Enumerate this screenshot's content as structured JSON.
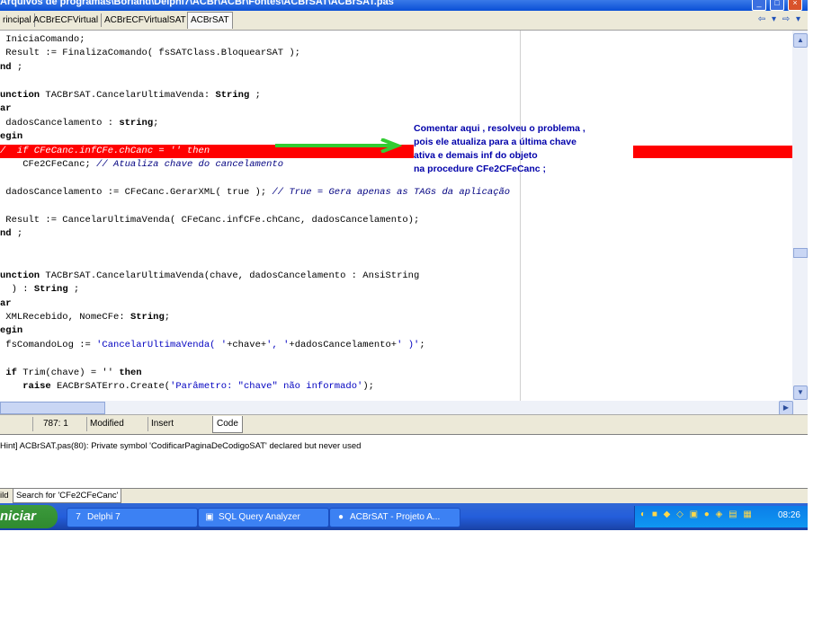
{
  "window": {
    "title": "Arquivos de programas\\Borland\\Delphi7\\ACBr\\ACBr\\Fontes\\ACBrSAT\\ACBrSAT.pas",
    "minimize_label": "_",
    "maximize_label": "□",
    "close_label": "×"
  },
  "tabs": [
    {
      "label": "rincipal"
    },
    {
      "label": "ACBrECFVirtual"
    },
    {
      "label": "ACBrECFVirtualSAT"
    },
    {
      "label": "ACBrSAT"
    }
  ],
  "nav": {
    "back_forward": "⇦ ▾ ⇨ ▾"
  },
  "code_lines": [
    {
      "parts": [
        {
          "t": " IniciaComando;",
          "c": ""
        }
      ]
    },
    {
      "parts": [
        {
          "t": " Result := FinalizaComando( fsSATClass.BloquearSAT );",
          "c": ""
        }
      ]
    },
    {
      "parts": [
        {
          "t": "nd",
          "c": "kw"
        },
        {
          "t": " ;",
          "c": ""
        }
      ]
    },
    {
      "parts": [
        {
          "t": "",
          "c": ""
        }
      ]
    },
    {
      "parts": [
        {
          "t": "unction",
          "c": "kw"
        },
        {
          "t": " TACBrSAT.CancelarUltimaVenda: ",
          "c": ""
        },
        {
          "t": "String",
          "c": "kw"
        },
        {
          "t": " ;",
          "c": ""
        }
      ]
    },
    {
      "parts": [
        {
          "t": "ar",
          "c": "kw"
        }
      ]
    },
    {
      "parts": [
        {
          "t": " dadosCancelamento : ",
          "c": ""
        },
        {
          "t": "string",
          "c": "kw"
        },
        {
          "t": ";",
          "c": ""
        }
      ]
    },
    {
      "parts": [
        {
          "t": "egin",
          "c": "kw"
        }
      ]
    },
    {
      "bp": true,
      "parts": [
        {
          "t": "/  if CFeCanc.infCFe.chCanc = '' then",
          "c": "cmt"
        }
      ]
    },
    {
      "parts": [
        {
          "t": "    CFe2CFeCanc; ",
          "c": ""
        },
        {
          "t": "// Atualiza chave do cancelamento",
          "c": "cmt"
        }
      ]
    },
    {
      "parts": [
        {
          "t": "",
          "c": ""
        }
      ]
    },
    {
      "parts": [
        {
          "t": " dadosCancelamento := CFeCanc.GerarXML( true ); ",
          "c": ""
        },
        {
          "t": "// True = Gera apenas as TAGs da aplicação",
          "c": "cmt"
        }
      ]
    },
    {
      "parts": [
        {
          "t": "",
          "c": ""
        }
      ]
    },
    {
      "parts": [
        {
          "t": " Result := CancelarUltimaVenda( CFeCanc.infCFe.chCanc, dadosCancelamento);",
          "c": ""
        }
      ]
    },
    {
      "parts": [
        {
          "t": "nd",
          "c": "kw"
        },
        {
          "t": " ;",
          "c": ""
        }
      ]
    },
    {
      "parts": [
        {
          "t": "",
          "c": ""
        }
      ]
    },
    {
      "parts": [
        {
          "t": "",
          "c": ""
        }
      ]
    },
    {
      "parts": [
        {
          "t": "unction",
          "c": "kw"
        },
        {
          "t": " TACBrSAT.CancelarUltimaVenda(chave, dadosCancelamento : AnsiString",
          "c": ""
        }
      ]
    },
    {
      "parts": [
        {
          "t": "  ) : ",
          "c": ""
        },
        {
          "t": "String",
          "c": "kw"
        },
        {
          "t": " ;",
          "c": ""
        }
      ]
    },
    {
      "parts": [
        {
          "t": "ar",
          "c": "kw"
        }
      ]
    },
    {
      "parts": [
        {
          "t": " XMLRecebido, NomeCFe: ",
          "c": ""
        },
        {
          "t": "String",
          "c": "kw"
        },
        {
          "t": ";",
          "c": ""
        }
      ]
    },
    {
      "parts": [
        {
          "t": "egin",
          "c": "kw"
        }
      ]
    },
    {
      "parts": [
        {
          "t": " fsComandoLog := ",
          "c": ""
        },
        {
          "t": "'CancelarUltimaVenda( '",
          "c": "str"
        },
        {
          "t": "+chave+",
          "c": ""
        },
        {
          "t": "', '",
          "c": "str"
        },
        {
          "t": "+dadosCancelamento+",
          "c": ""
        },
        {
          "t": "' )'",
          "c": "str"
        },
        {
          "t": ";",
          "c": ""
        }
      ]
    },
    {
      "parts": [
        {
          "t": "",
          "c": ""
        }
      ]
    },
    {
      "parts": [
        {
          "t": " ",
          "c": ""
        },
        {
          "t": "if",
          "c": "kw"
        },
        {
          "t": " Trim(chave) = '' ",
          "c": ""
        },
        {
          "t": "then",
          "c": "kw"
        }
      ]
    },
    {
      "parts": [
        {
          "t": "    ",
          "c": ""
        },
        {
          "t": "raise",
          "c": "kw"
        },
        {
          "t": " EACBrSATErro.Create(",
          "c": ""
        },
        {
          "t": "'Parâmetro: \"chave\" não informado'",
          "c": "str"
        },
        {
          "t": ");",
          "c": ""
        }
      ]
    }
  ],
  "annotation": {
    "lines": [
      "Comentar aqui , resolveu o problema ,",
      "pois ele atualiza para a última chave",
      "ativa e demais inf do objeto",
      "na procedure CFe2CFeCanc ;"
    ],
    "arrow_color": "#33cc33",
    "highlight_color": "#ff0000"
  },
  "status": {
    "position": "787:  1",
    "state": "Modified",
    "mode": "Insert",
    "view_tab": "Code"
  },
  "messages": [
    "Hint] ACBrSAT.pas(80): Private symbol 'CodificarPaginaDeCodigoSAT' declared but never used"
  ],
  "message_tabs": [
    "ild",
    "Search for 'CFe2CFeCanc'"
  ],
  "taskbar": {
    "start_label": "niciar",
    "tasks": [
      {
        "label": "Delphi 7",
        "icon": "7"
      },
      {
        "label": "SQL Query Analyzer",
        "icon": "▣"
      },
      {
        "label": "ACBrSAT - Projeto A...",
        "icon": "●"
      }
    ],
    "tray_icons": "◐ ■ ◆ ◇ ▣ ● ◈ ▤ ▦",
    "clock": "08:26"
  }
}
